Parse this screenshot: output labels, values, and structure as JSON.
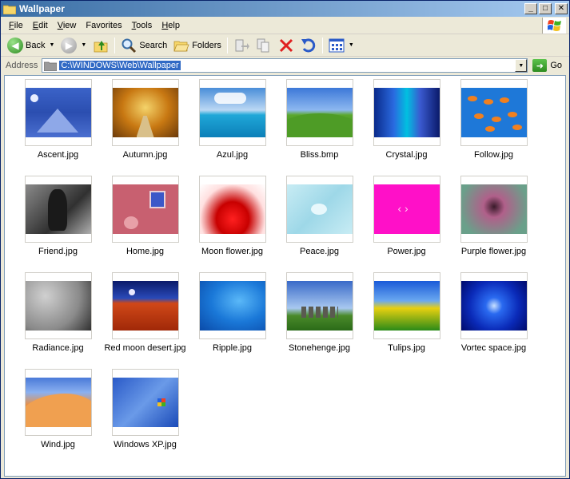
{
  "window": {
    "title": "Wallpaper"
  },
  "title_controls": {
    "minimize": "_",
    "maximize": "□",
    "close": "✕"
  },
  "menu": [
    {
      "label": "File",
      "accel": "F",
      "rest": "ile"
    },
    {
      "label": "Edit",
      "accel": "E",
      "rest": "dit"
    },
    {
      "label": "View",
      "accel": "V",
      "rest": "iew"
    },
    {
      "label": "Favorites",
      "accel": "",
      "rest": "Favorites"
    },
    {
      "label": "Tools",
      "accel": "T",
      "rest": "ools"
    },
    {
      "label": "Help",
      "accel": "H",
      "rest": "elp"
    }
  ],
  "toolbar": {
    "back_label": "Back",
    "search_label": "Search",
    "folders_label": "Folders"
  },
  "address": {
    "label": "Address",
    "path": "C:\\WINDOWS\\Web\\Wallpaper",
    "go_label": "Go"
  },
  "files": [
    {
      "name": "Ascent.jpg",
      "thumb": "t-ascent"
    },
    {
      "name": "Autumn.jpg",
      "thumb": "t-autumn"
    },
    {
      "name": "Azul.jpg",
      "thumb": "t-azul"
    },
    {
      "name": "Bliss.bmp",
      "thumb": "t-bliss"
    },
    {
      "name": "Crystal.jpg",
      "thumb": "t-crystal"
    },
    {
      "name": "Follow.jpg",
      "thumb": "t-follow"
    },
    {
      "name": "Friend.jpg",
      "thumb": "t-friend"
    },
    {
      "name": "Home.jpg",
      "thumb": "t-home"
    },
    {
      "name": "Moon flower.jpg",
      "thumb": "t-moon"
    },
    {
      "name": "Peace.jpg",
      "thumb": "t-peace"
    },
    {
      "name": "Power.jpg",
      "thumb": "t-power"
    },
    {
      "name": "Purple flower.jpg",
      "thumb": "t-purple"
    },
    {
      "name": "Radiance.jpg",
      "thumb": "t-radiance"
    },
    {
      "name": "Red moon desert.jpg",
      "thumb": "t-redmoon"
    },
    {
      "name": "Ripple.jpg",
      "thumb": "t-ripple"
    },
    {
      "name": "Stonehenge.jpg",
      "thumb": "t-stone"
    },
    {
      "name": "Tulips.jpg",
      "thumb": "t-tulips"
    },
    {
      "name": "Vortec space.jpg",
      "thumb": "t-vortec"
    },
    {
      "name": "Wind.jpg",
      "thumb": "t-wind"
    },
    {
      "name": "Windows XP.jpg",
      "thumb": "t-winxp"
    }
  ],
  "icons": {
    "window": "folder-icon",
    "back": "back-arrow-icon",
    "forward": "forward-arrow-icon",
    "up": "up-folder-icon",
    "search": "magnifier-icon",
    "folders": "folders-icon",
    "move_to": "move-to-icon",
    "copy_to": "copy-to-icon",
    "delete": "delete-icon",
    "undo": "undo-icon",
    "views": "views-icon"
  },
  "colors": {
    "title_start": "#3A6EA5",
    "title_end": "#A6CAF0",
    "selection": "#316AC5",
    "chrome": "#ECE9D8"
  }
}
